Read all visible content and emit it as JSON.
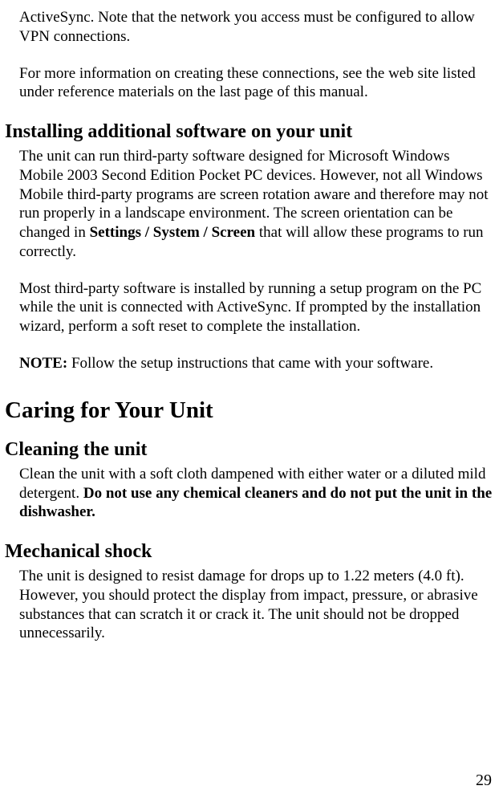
{
  "intro": {
    "p1": "ActiveSync. Note that the network you access must be configured to allow VPN connections.",
    "p2": "For more information on creating these connections, see the web site listed under reference materials on the last page of this manual."
  },
  "section1": {
    "heading": "Installing additional software on your unit",
    "p1_a": "The unit can run third-party software designed for Microsoft Windows Mobile 2003 Second Edition Pocket PC devices. However, not all Windows Mobile third-party programs are screen rotation aware and therefore may not run properly in a landscape environment. The screen orientation can be changed in ",
    "p1_bold": "Settings / System / Screen",
    "p1_b": " that will allow these programs to run correctly.",
    "p2": "Most third-party software is installed by running a setup program on the PC while the unit is connected with ActiveSync. If prompted by the installation wizard, perform a soft reset to complete the installation.",
    "note_label": "NOTE:",
    "note_text": " Follow the setup instructions that came with your software."
  },
  "section2": {
    "heading": "Caring for Your Unit",
    "sub1": {
      "heading": "Cleaning the unit",
      "p1_a": "Clean the unit with a soft cloth dampened with either water or a diluted mild detergent. ",
      "p1_bold": "Do not use any chemical cleaners and do not put the unit in the dishwasher."
    },
    "sub2": {
      "heading": "Mechanical shock",
      "p1": "The unit is designed to resist damage for drops up to 1.22 meters (4.0 ft). However, you should protect the display from impact, pressure, or abrasive substances that can scratch it or crack it. The unit should not be dropped unnecessarily."
    }
  },
  "page_number": "29"
}
